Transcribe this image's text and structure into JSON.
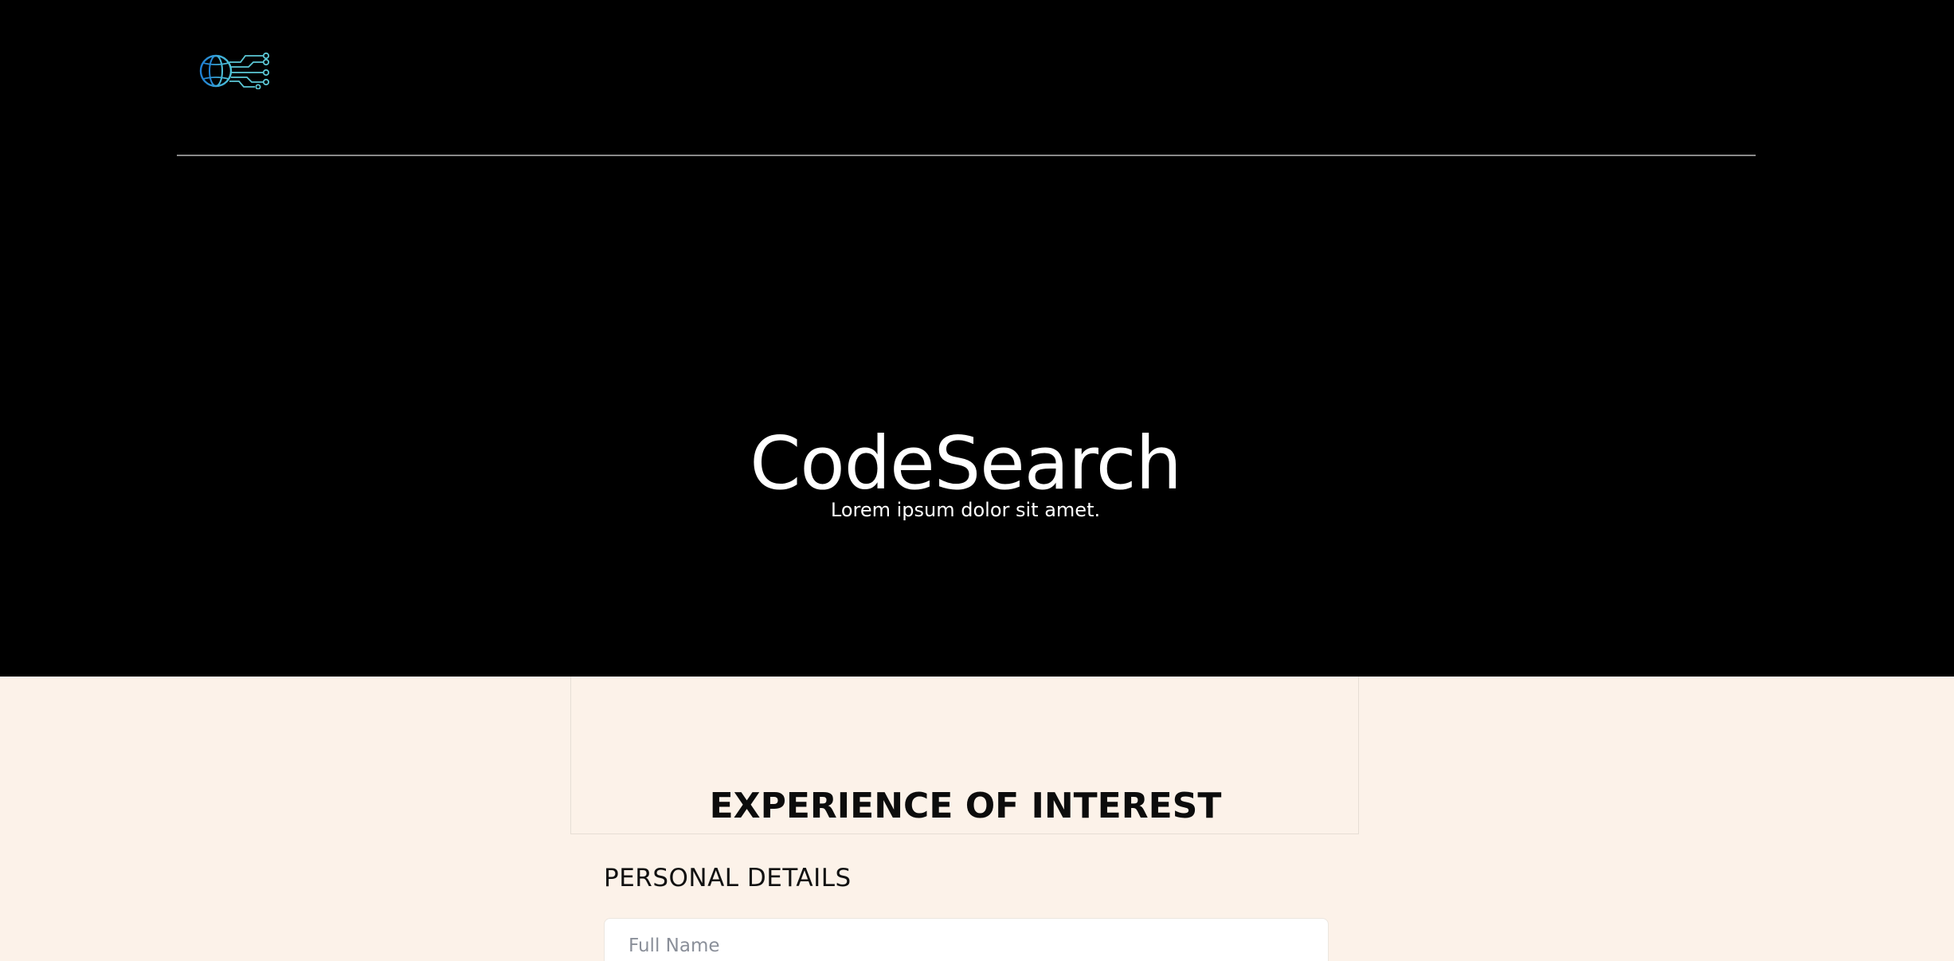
{
  "header": {
    "logo_icon": "globe-circuit-icon",
    "accent_color": "#2d8fd6"
  },
  "hero": {
    "title": "CodeSearch",
    "subtitle": "Lorem ipsum dolor sit amet."
  },
  "form": {
    "section_title": "EXPERIENCE OF INTEREST",
    "personal_heading": "PERSONAL DETAILS",
    "full_name_placeholder": "Full Name",
    "full_name_value": ""
  },
  "colors": {
    "hero_background": "#000000",
    "page_background": "#fcf2e9"
  }
}
